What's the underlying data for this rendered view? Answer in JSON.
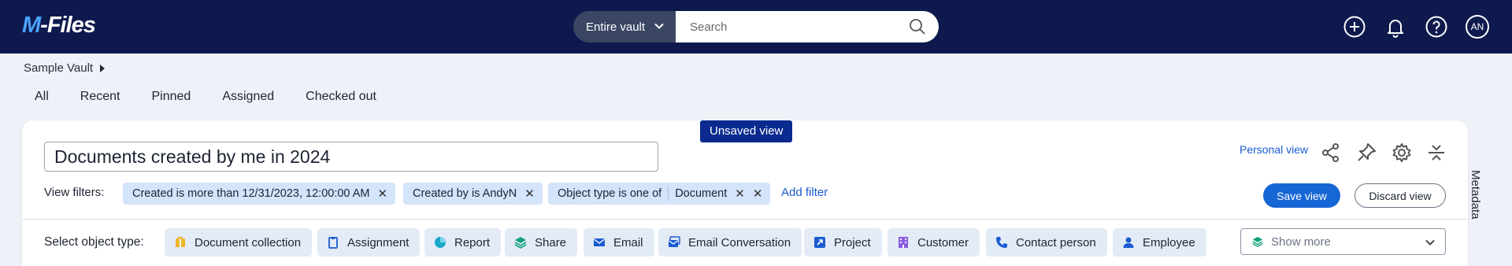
{
  "app": {
    "logo_prefix": "M",
    "logo_rest": "-Files"
  },
  "search": {
    "scope": "Entire vault",
    "placeholder": "Search"
  },
  "user": {
    "initials": "AN"
  },
  "breadcrumb": {
    "vault": "Sample Vault"
  },
  "tabs": [
    {
      "label": "All"
    },
    {
      "label": "Recent"
    },
    {
      "label": "Pinned"
    },
    {
      "label": "Assigned"
    },
    {
      "label": "Checked out"
    }
  ],
  "view": {
    "badge": "Unsaved view",
    "title": "Documents created by me in 2024",
    "personal_label": "Personal view",
    "filters_label": "View filters:",
    "filters": [
      {
        "label": "Created is more than 12/31/2023, 12:00:00 AM"
      },
      {
        "label": "Created by is AndyN"
      },
      {
        "label": "Object type is one of",
        "value": "Document"
      }
    ],
    "add_filter": "Add filter",
    "save_label": "Save view",
    "discard_label": "Discard view"
  },
  "object_types": {
    "label": "Select object type:",
    "items": [
      {
        "label": "Document collection",
        "icon": "document-collection-icon",
        "color": "#f0b429"
      },
      {
        "label": "Assignment",
        "icon": "assignment-icon",
        "color": "#1a5bd1"
      },
      {
        "label": "Report",
        "icon": "report-icon",
        "color": "#1aa7c9"
      },
      {
        "label": "Share",
        "icon": "share-layers-icon",
        "color": "#12a37c"
      },
      {
        "label": "Email",
        "icon": "email-icon",
        "color": "#1a5bd1"
      },
      {
        "label": "Email Conversation",
        "icon": "email-conversation-icon",
        "color": "#1a5bd1"
      },
      {
        "label": "Project",
        "icon": "project-icon",
        "color": "#1a5bd1"
      },
      {
        "label": "Customer",
        "icon": "customer-icon",
        "color": "#8a5be0"
      },
      {
        "label": "Contact person",
        "icon": "contact-person-icon",
        "color": "#1a5bd1"
      },
      {
        "label": "Employee",
        "icon": "employee-icon",
        "color": "#1a5bd1"
      }
    ],
    "show_more": "Show more"
  },
  "side_panel": {
    "label": "Metadata"
  },
  "colors": {
    "topbar": "#0e1a4d",
    "accent": "#1766d6",
    "chip": "#d4e4fb",
    "badge": "#0a2a8f"
  }
}
